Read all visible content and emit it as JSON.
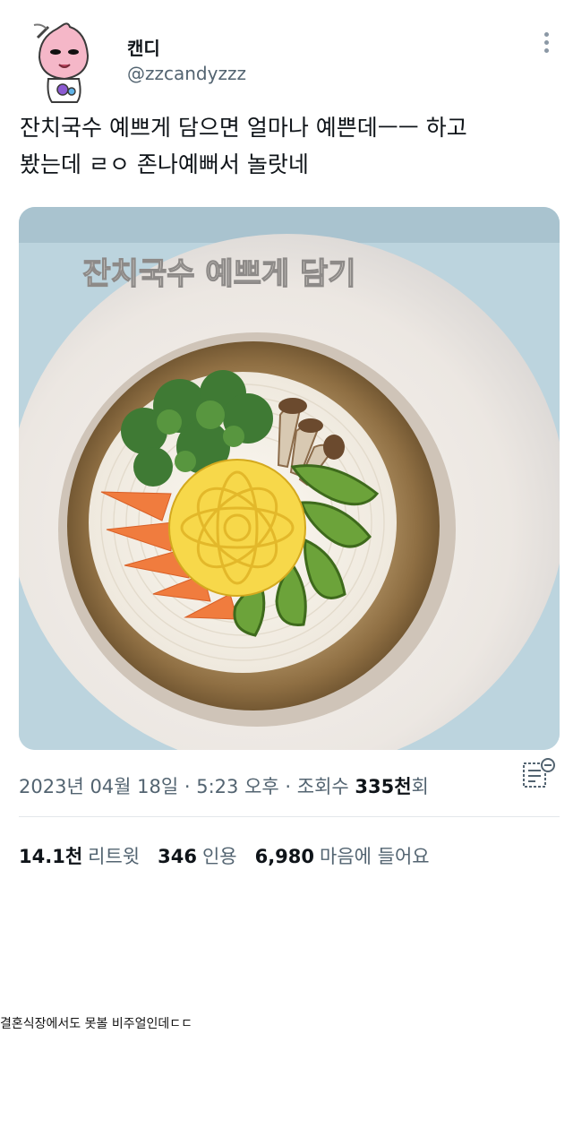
{
  "user": {
    "display_name": "캔디",
    "handle": "@zzcandyzzz",
    "avatar_icon": "peach-character-avatar"
  },
  "tweet": {
    "text_line1": "잔치국수 예쁘게 담으면 얼마나 예쁜데ㅡㅡ 하고",
    "text_line2": "봤는데 ㄹㅇ 존나예뻐서 놀랏네"
  },
  "media": {
    "overlay_text": "잔치국수 예쁘게 담기"
  },
  "meta": {
    "date": "2023년 04월 18일",
    "sep1": " · ",
    "time": "5:23 오후",
    "sep2": " · ",
    "views_label": "조회수 ",
    "views_value": "335천",
    "views_suffix": "회"
  },
  "stats": {
    "retweets_value": "14.1천",
    "retweets_label": "리트윗",
    "quotes_value": "346",
    "quotes_label": "인용",
    "likes_value": "6,980",
    "likes_label": "마음에 들어요"
  },
  "caption": "결혼식장에서도 못볼 비주얼인데ㄷㄷ",
  "icons": {
    "more": "more-vertical-icon",
    "analytics": "analytics-icon"
  }
}
